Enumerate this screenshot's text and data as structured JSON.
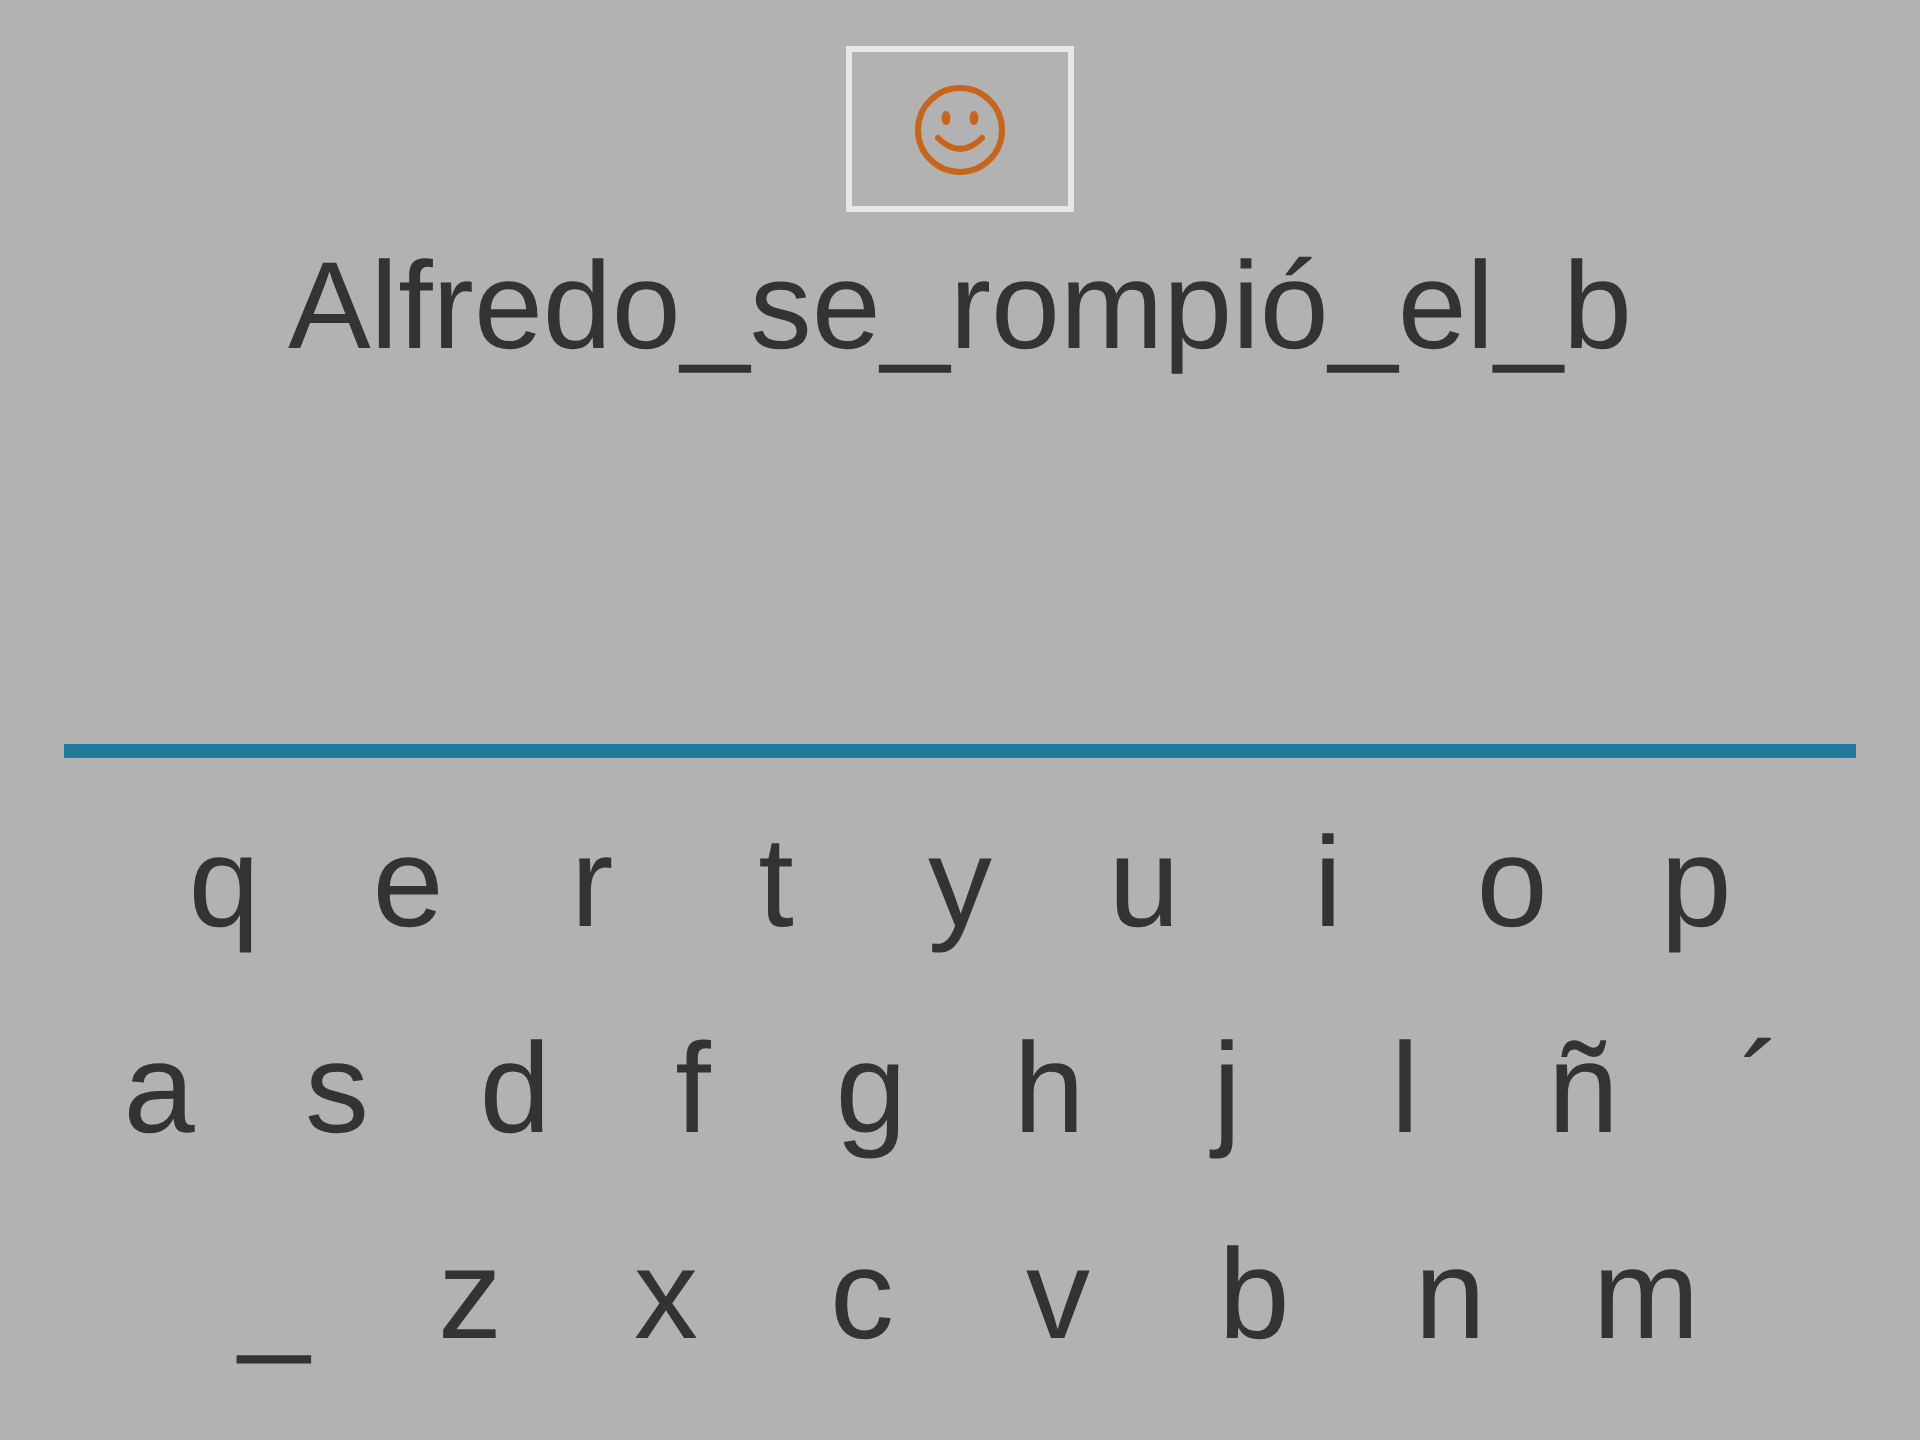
{
  "feedback": {
    "kind": "happy"
  },
  "prompt": "Alfredo_se_rompió_el_b",
  "keyboard": {
    "rows": [
      [
        "q",
        "e",
        "r",
        "t",
        "y",
        "u",
        "i",
        "o",
        "p"
      ],
      [
        "a",
        "s",
        "d",
        "f",
        "g",
        "h",
        "j",
        "l",
        "ñ",
        "´"
      ],
      [
        "_",
        "z",
        "x",
        "c",
        "v",
        "b",
        "n",
        "m"
      ]
    ]
  }
}
